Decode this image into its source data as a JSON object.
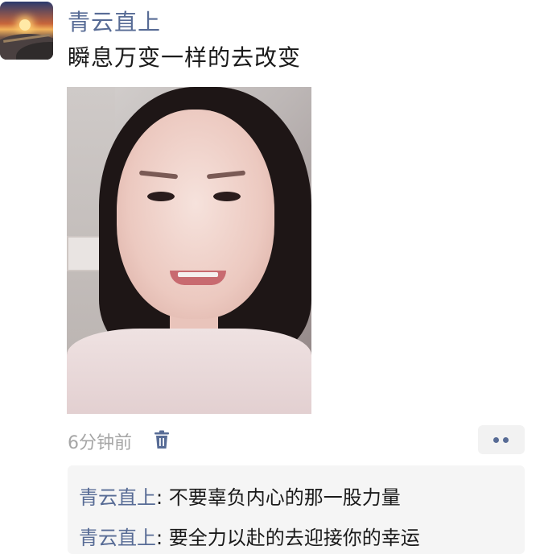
{
  "post": {
    "username": "青云直上",
    "text": "瞬息万变一样的去改变",
    "timestamp": "6分钟前"
  },
  "comments": [
    {
      "author": "青云直上",
      "separator": ": ",
      "text": "不要辜负内心的那一股力量"
    },
    {
      "author": "青云直上",
      "separator": ": ",
      "text": "要全力以赴的去迎接你的幸运"
    }
  ],
  "colors": {
    "link": "#576b95",
    "muted": "#a6a6a6",
    "comment_bg": "#f5f5f5"
  },
  "icons": {
    "avatar": "sunrise-great-wall-avatar",
    "delete": "trash-icon",
    "more": "more-dots-icon"
  }
}
